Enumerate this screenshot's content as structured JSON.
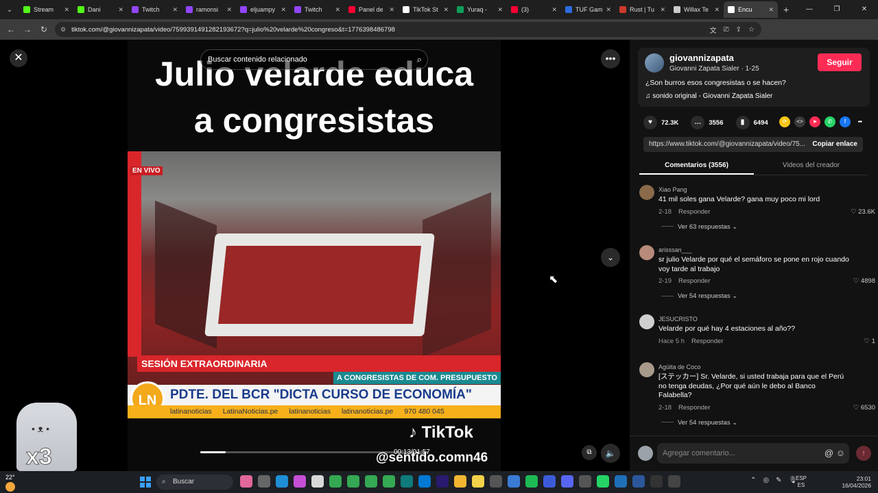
{
  "browser": {
    "tabs": [
      {
        "title": "Stream",
        "color": "#53fc18",
        "active": false
      },
      {
        "title": "Dani",
        "color": "#53fc18",
        "active": false
      },
      {
        "title": "Twitch",
        "color": "#9146ff",
        "active": false
      },
      {
        "title": "ramonsi",
        "color": "#9146ff",
        "active": false
      },
      {
        "title": "eljuampy",
        "color": "#9146ff",
        "active": false
      },
      {
        "title": "Twitch",
        "color": "#9146ff",
        "active": false
      },
      {
        "title": "Panel de",
        "color": "#ff0033",
        "active": false
      },
      {
        "title": "TikTok St",
        "color": "#ffffff",
        "active": false
      },
      {
        "title": "Yuraq -",
        "color": "#0f9d58",
        "active": false
      },
      {
        "title": "(3)",
        "color": "#ff0033",
        "active": false
      },
      {
        "title": "TUF Gam",
        "color": "#2d6cdf",
        "active": false
      },
      {
        "title": "Rust | Tu",
        "color": "#cd3a2b",
        "active": false
      },
      {
        "title": "Willax Te",
        "color": "#cccccc",
        "active": false
      },
      {
        "title": "Encu",
        "color": "#ffffff",
        "active": true
      }
    ],
    "url": "tiktok.com/@giovannizapata/video/7599391491282193672?q=julio%20velarde%20congreso&t=1776398486798"
  },
  "video": {
    "title_line1": "Julio velarde educa",
    "title_line2": "a congresistas",
    "search_placeholder": "Buscar contenido relacionado",
    "en_vivo": "EN VIVO",
    "sesion": "SESIÓN EXTRAORDINARIA",
    "comision": "A CONGRESISTAS DE COM. PRESUPUESTO",
    "ln_logo": "LN",
    "pdte": "PDTE. DEL BCR \"DICTA CURSO DE ECONOMÍA\"",
    "social": [
      "latinanoticias",
      "LatinaNoticias.pe",
      "latinanoticias",
      "latinanoticias.pe",
      "970 480 045"
    ],
    "tiktok_watermark": "TikTok",
    "handle_watermark": "@sentido.comn46",
    "time": "00:13/01:57",
    "progress": 0.111
  },
  "author": {
    "username": "giovannizapata",
    "name_date": "Giovanni Zapata Sialer · 1-25",
    "follow_label": "Seguir",
    "description": "¿Son burros esos congresistas o se hacen?",
    "sound": "♫  sonido original - Giovanni Zapata Sialer"
  },
  "stats": {
    "likes": "72.3K",
    "comments": "3556",
    "saves": "6494"
  },
  "link": {
    "url": "https://www.tiktok.com/@giovannizapata/video/75...",
    "copy_label": "Copiar enlace"
  },
  "tabs": {
    "comments": "Comentarios (3556)",
    "creator": "Videos del creador"
  },
  "comments": [
    {
      "user": "Xiao Pang",
      "text": "41 mil soles gana Velarde? gana muy poco mi lord",
      "date": "2-18",
      "reply": "Responder",
      "likes": "23.6K",
      "more": "Ver 63 respuestas ⌄",
      "avatar": "#8a6a4a"
    },
    {
      "user": "arisssan___",
      "text": "sr julio Velarde por qué el semáforo se pone en rojo cuando voy tarde al trabajo",
      "date": "2-19",
      "reply": "Responder",
      "likes": "4898",
      "more": "Ver 54 respuestas ⌄",
      "avatar": "#b88a7a"
    },
    {
      "user": "JESUCRISTO",
      "text": "Velarde por qué hay 4 estaciones al año??",
      "date": "Hace 5 h",
      "reply": "Responder",
      "likes": "1",
      "more": "",
      "avatar": "#cfcfcf"
    },
    {
      "user": "Agüita de Coco",
      "text": "[ステッカー] Sr. Velarde, si usted trabaja para que el Perú no tenga deudas, ¿Por qué aún le debo al Banco Falabella?",
      "date": "2-18",
      "reply": "Responder",
      "likes": "6530",
      "more": "Ver 54 respuestas ⌄",
      "avatar": "#a89a8a"
    }
  ],
  "compose": {
    "placeholder": "Agregar comentario..."
  },
  "taskbar": {
    "temp": "22°",
    "search": "Buscar",
    "lang1": "ESP",
    "lang2": "ES",
    "time": "23:01",
    "date": "16/04/2026"
  }
}
